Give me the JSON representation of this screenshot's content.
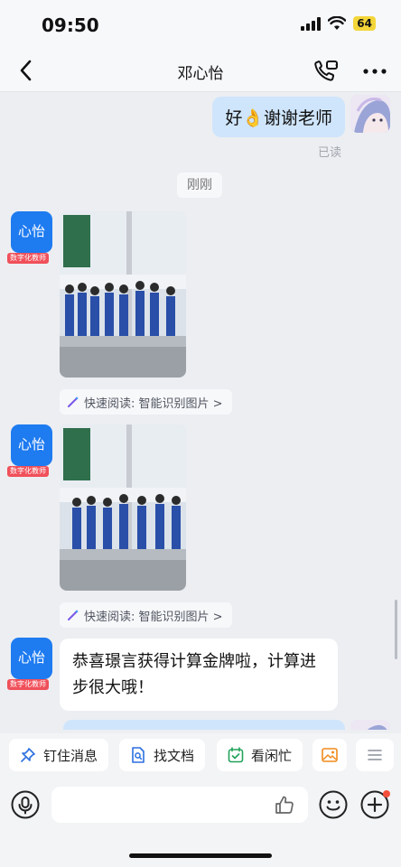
{
  "status_bar": {
    "time": "09:50",
    "battery": "64"
  },
  "nav": {
    "title": "邓心怡"
  },
  "messages": {
    "outgoing_1": "好👌谢谢老师",
    "read_status": "已读",
    "time_label": "刚刚",
    "teacher_avatar_text": "心怡",
    "teacher_badge": "数字化教师",
    "quick_read": "快速阅读: 智能识别图片 >",
    "incoming_text": "恭喜璟言获得计算金牌啦，计算进步很大哦！"
  },
  "shortcuts": [
    {
      "label": "钉住消息",
      "icon": "pin-icon"
    },
    {
      "label": "找文档",
      "icon": "search-doc-icon"
    },
    {
      "label": "看闲忙",
      "icon": "calendar-check-icon"
    },
    {
      "label": "",
      "icon": "image-icon"
    },
    {
      "label": "",
      "icon": "menu-icon"
    }
  ],
  "colors": {
    "accent": "#1e7bf0",
    "bubble_out": "#cfe5fb",
    "badge": "#f0505a",
    "battery": "#f4d63a"
  }
}
